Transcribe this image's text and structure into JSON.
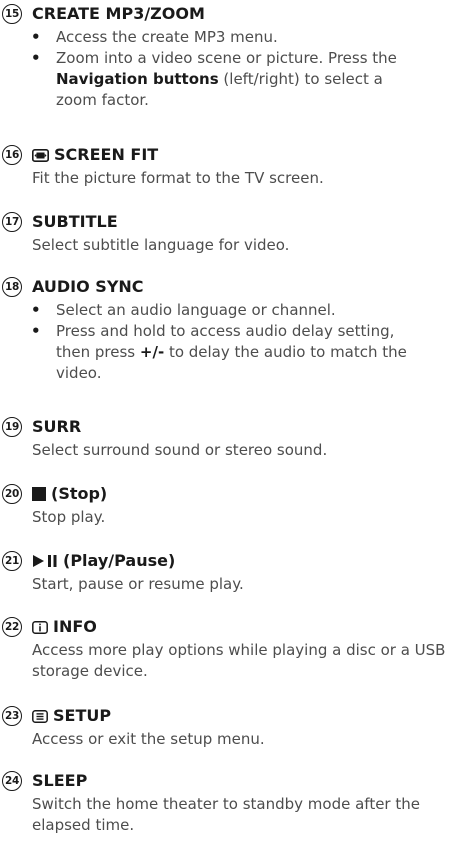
{
  "entries": [
    {
      "number": "15",
      "title": "CREATE MP3/ZOOM",
      "bullets": [
        "Access the create MP3 menu.",
        {
          "before": "Zoom into a video scene or picture. Press the ",
          "bold": "Navigation buttons",
          "after": " (left/right) to select a zoom factor."
        }
      ]
    },
    {
      "number": "16",
      "icon": "screen-fit-icon",
      "title": "SCREEN FIT",
      "description": "Fit the picture format to the TV screen."
    },
    {
      "number": "17",
      "title": "SUBTITLE",
      "description": "Select subtitle language for video."
    },
    {
      "number": "18",
      "title": "AUDIO SYNC",
      "bullets": [
        "Select an audio language or channel.",
        {
          "before": "Press and hold to access audio delay setting, then press ",
          "bold": "+/-",
          "after": " to delay the audio to match the video."
        }
      ]
    },
    {
      "number": "19",
      "title": "SURR",
      "description": "Select surround sound or stereo sound."
    },
    {
      "number": "20",
      "icon": "stop-icon",
      "title": "(Stop)",
      "description": "Stop play."
    },
    {
      "number": "21",
      "icon": "play-pause-icon",
      "title": "(Play/Pause)",
      "description": "Start, pause or resume play."
    },
    {
      "number": "22",
      "icon": "info-icon",
      "title": "INFO",
      "description": "Access more play options while playing a disc or a USB storage device."
    },
    {
      "number": "23",
      "icon": "setup-icon",
      "title": "SETUP",
      "description": "Access or exit the setup menu."
    },
    {
      "number": "24",
      "title": "SLEEP",
      "description": "Switch the home theater to standby mode after the elapsed time."
    }
  ]
}
